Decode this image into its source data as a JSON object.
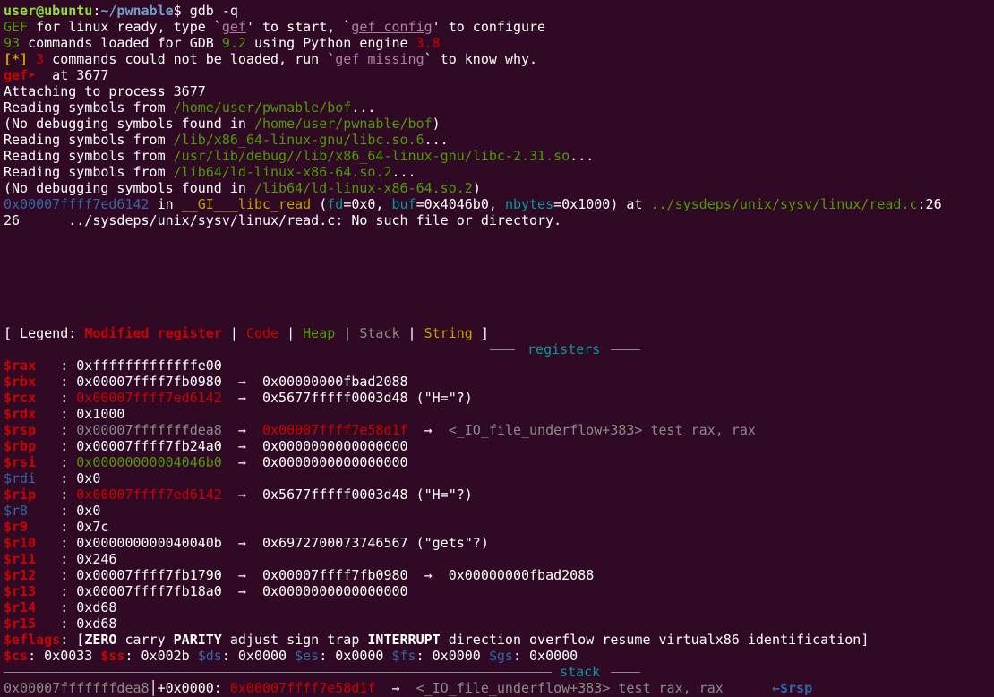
{
  "prompt": {
    "user_host": "user@ubuntu",
    "colon": ":",
    "path": "~/pwnable",
    "dollar": "$ ",
    "command": "gdb -q"
  },
  "gef_banner": {
    "l1_a": "GEF",
    "l1_b": " for linux ready, type `",
    "l1_cmd1": "gef",
    "l1_c": "' to start, `",
    "l1_cmd2": "gef config",
    "l1_d": "' to configure",
    "l2_count": "93",
    "l2_a": " commands loaded for GDB ",
    "l2_gdbver": "9.2",
    "l2_b": " using Python engine ",
    "l2_pyver": "3.8",
    "l3_tag": "[*]",
    "l3_count": " 3",
    "l3_a": " commands could not be loaded, run `",
    "l3_cmd": "gef missing",
    "l3_b": "` to know why."
  },
  "gef_prompt": {
    "label": "gef➤ ",
    "command": " at 3677"
  },
  "attach": {
    "attaching": "Attaching to process 3677",
    "reading1_a": "Reading symbols from ",
    "reading1_path": "/home/user/pwnable/bof",
    "reading1_b": "...",
    "nodebug1_a": "(No debugging symbols found in ",
    "nodebug1_path": "/home/user/pwnable/bof",
    "nodebug1_b": ")",
    "reading2_a": "Reading symbols from ",
    "reading2_path": "/lib/x86_64-linux-gnu/libc.so.6",
    "reading2_b": "...",
    "reading3_a": "Reading symbols from ",
    "reading3_path": "/usr/lib/debug//lib/x86_64-linux-gnu/libc-2.31.so",
    "reading3_b": "...",
    "reading4_a": "Reading symbols from ",
    "reading4_path": "/lib64/ld-linux-x86-64.so.2",
    "reading4_b": "...",
    "nodebug2_a": "(No debugging symbols found in ",
    "nodebug2_path": "/lib64/ld-linux-x86-64.so.2",
    "nodebug2_b": ")",
    "frame_addr": "0x00007ffff7ed6142",
    "frame_in": " in ",
    "frame_func": "__GI___libc_read",
    "frame_open": " (",
    "frame_arg1_name": "fd",
    "frame_arg1_val": "=0x0, ",
    "frame_arg2_name": "buf",
    "frame_arg2_val": "=0x4046b0, ",
    "frame_arg3_name": "nbytes",
    "frame_arg3_val": "=0x1000) at ",
    "frame_file": "../sysdeps/unix/sysv/linux/read.c",
    "frame_line": ":26",
    "source_line": "26\t../sysdeps/unix/sysv/linux/read.c: No such file or directory."
  },
  "legend": {
    "open": "[ Legend: ",
    "modified": "Modified register",
    "sep": " | ",
    "code": "Code",
    "heap": "Heap",
    "stack": "Stack",
    "string": "String",
    "close": " ]"
  },
  "sections": {
    "registers": " registers ",
    "stack": " stack "
  },
  "registers": [
    {
      "name": "$rax   ",
      "name_color": "red",
      "value": "0xfffffffffffffe00",
      "value_color": "white",
      "chain": []
    },
    {
      "name": "$rbx   ",
      "name_color": "red",
      "value": "0x00007ffff7fb0980",
      "value_color": "white",
      "chain": [
        {
          "text": "0x00000000fbad2088",
          "color": "white"
        }
      ]
    },
    {
      "name": "$rcx   ",
      "name_color": "red",
      "value": "0x00007ffff7ed6142",
      "value_color": "red",
      "chain": [
        {
          "text": "0x5677fffff0003d48 (\"H=\"?)",
          "color": "white"
        }
      ]
    },
    {
      "name": "$rdx   ",
      "name_color": "red",
      "value": "0x1000",
      "value_color": "white",
      "chain": []
    },
    {
      "name": "$rsp   ",
      "name_color": "red",
      "value": "0x00007fffffffdea8",
      "value_color": "gray",
      "chain": [
        {
          "text": "0x00007ffff7e58d1f",
          "color": "red"
        },
        {
          "text": "<_IO_file_underflow+383> test rax, rax",
          "color": "gray"
        }
      ]
    },
    {
      "name": "$rbp   ",
      "name_color": "red",
      "value": "0x00007ffff7fb24a0",
      "value_color": "white",
      "chain": [
        {
          "text": "0x0000000000000000",
          "color": "white"
        }
      ]
    },
    {
      "name": "$rsi   ",
      "name_color": "red",
      "value": "0x00000000004046b0",
      "value_color": "green",
      "chain": [
        {
          "text": "0x0000000000000000",
          "color": "white"
        }
      ]
    },
    {
      "name": "$rdi   ",
      "name_color": "blue",
      "value": "0x0",
      "value_color": "white",
      "chain": []
    },
    {
      "name": "$rip   ",
      "name_color": "red",
      "value": "0x00007ffff7ed6142",
      "value_color": "red",
      "chain": [
        {
          "text": "0x5677fffff0003d48 (\"H=\"?)",
          "color": "white"
        }
      ]
    },
    {
      "name": "$r8    ",
      "name_color": "blue",
      "value": "0x0",
      "value_color": "white",
      "chain": []
    },
    {
      "name": "$r9    ",
      "name_color": "red",
      "value": "0x7c",
      "value_color": "white",
      "chain": []
    },
    {
      "name": "$r10   ",
      "name_color": "red",
      "value": "0x000000000040040b",
      "value_color": "white",
      "chain": [
        {
          "text": "0x6972700073746567 (\"gets\"?)",
          "color": "white"
        }
      ]
    },
    {
      "name": "$r11   ",
      "name_color": "red",
      "value": "0x246",
      "value_color": "white",
      "chain": []
    },
    {
      "name": "$r12   ",
      "name_color": "red",
      "value": "0x00007ffff7fb1790",
      "value_color": "white",
      "chain": [
        {
          "text": "0x00007ffff7fb0980",
          "color": "white"
        },
        {
          "text": "0x00000000fbad2088",
          "color": "white"
        }
      ]
    },
    {
      "name": "$r13   ",
      "name_color": "red",
      "value": "0x00007ffff7fb18a0",
      "value_color": "white",
      "chain": [
        {
          "text": "0x0000000000000000",
          "color": "white"
        }
      ]
    },
    {
      "name": "$r14   ",
      "name_color": "red",
      "value": "0xd68",
      "value_color": "white",
      "chain": []
    },
    {
      "name": "$r15   ",
      "name_color": "red",
      "value": "0xd68",
      "value_color": "white",
      "chain": []
    }
  ],
  "colon_sep": ": ",
  "arrow": "  →  ",
  "eflags": {
    "name": "$eflags",
    "open": ": [",
    "flags": [
      {
        "text": "ZERO",
        "bold": true
      },
      {
        "text": "carry",
        "bold": false
      },
      {
        "text": "PARITY",
        "bold": true
      },
      {
        "text": "adjust",
        "bold": false
      },
      {
        "text": "sign",
        "bold": false
      },
      {
        "text": "trap",
        "bold": false
      },
      {
        "text": "INTERRUPT",
        "bold": true
      },
      {
        "text": "direction",
        "bold": false
      },
      {
        "text": "overflow",
        "bold": false
      },
      {
        "text": "resume",
        "bold": false
      },
      {
        "text": "virtualx86",
        "bold": false
      },
      {
        "text": "identification",
        "bold": false
      }
    ],
    "close": "]"
  },
  "segments": [
    {
      "name": "$cs",
      "name_color": "red",
      "value": ": 0x0033 "
    },
    {
      "name": "$ss",
      "name_color": "red",
      "value": ": 0x002b "
    },
    {
      "name": "$ds",
      "name_color": "blue",
      "value": ": 0x0000 "
    },
    {
      "name": "$es",
      "name_color": "blue",
      "value": ": 0x0000 "
    },
    {
      "name": "$fs",
      "name_color": "blue",
      "value": ": 0x0000 "
    },
    {
      "name": "$gs",
      "name_color": "blue",
      "value": ": 0x0000"
    }
  ],
  "stack_row": {
    "addr": "0x00007fffffffdea8",
    "offset": "│+0x0000: ",
    "value": "0x00007ffff7e58d1f",
    "arrow": "  →  ",
    "symbol": "<_IO_file_underflow+383> test rax, rax",
    "gap": "      ",
    "pointer": "←$rsp"
  },
  "colors": {
    "background": "#300a24",
    "red": "#cc0000",
    "green": "#4e9a06",
    "yellow": "#c4a000",
    "blue": "#3465a4",
    "cyan": "#06989a",
    "gray": "#8a8a8a",
    "magenta": "#75507b"
  }
}
